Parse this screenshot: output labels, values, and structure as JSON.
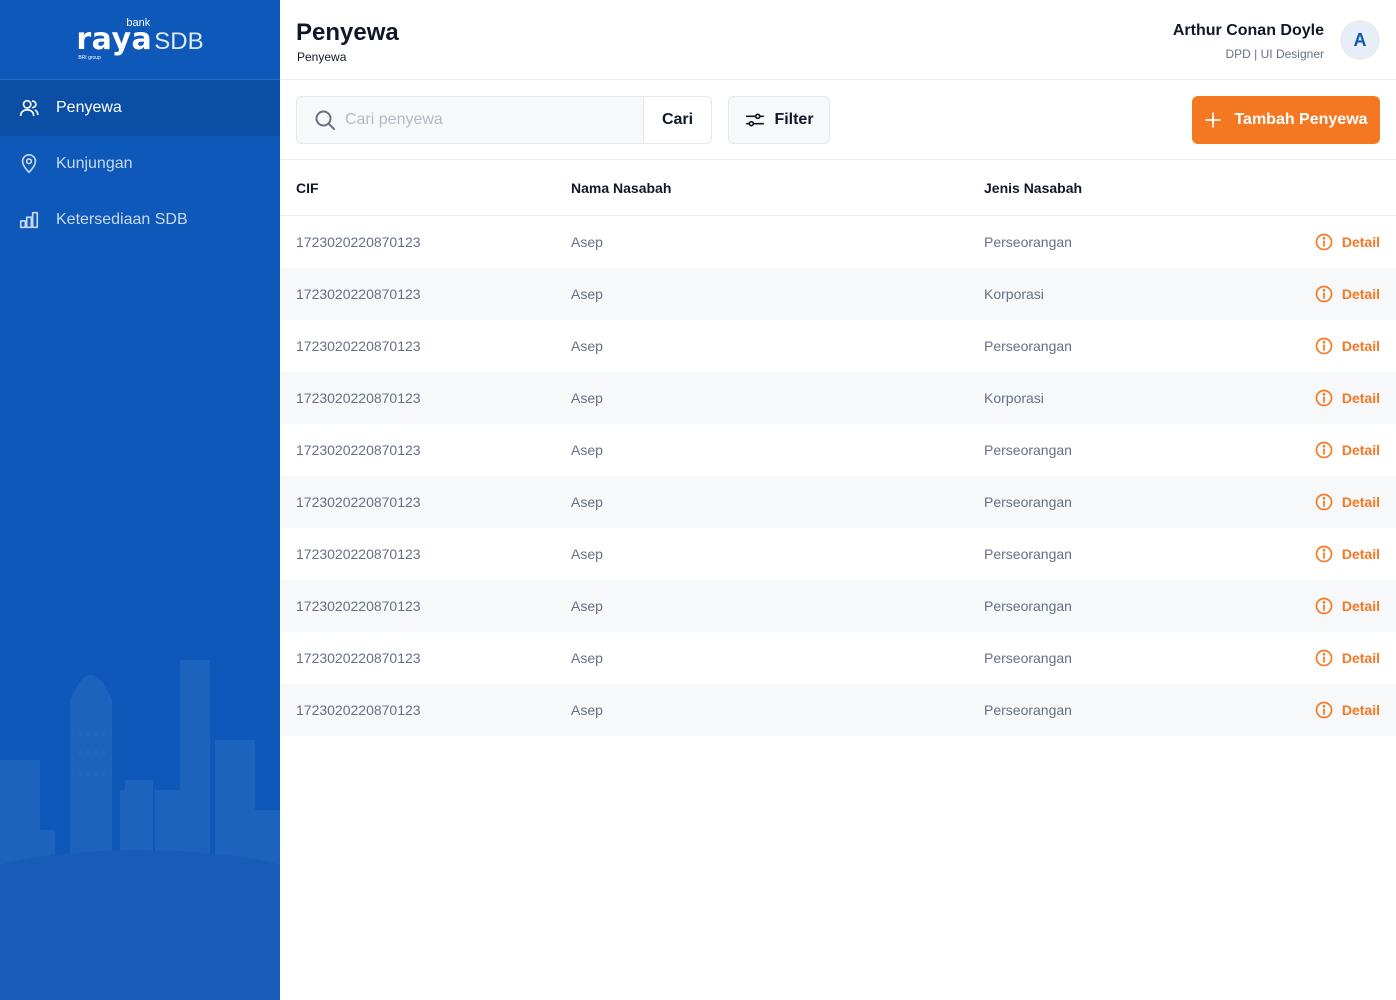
{
  "app": {
    "logo": {
      "bank": "bank",
      "raya": "raya",
      "sdb": "SDB",
      "group": "BRI group"
    }
  },
  "sidebar": {
    "items": [
      {
        "label": "Penyewa",
        "icon": "users-icon",
        "active": true
      },
      {
        "label": "Kunjungan",
        "icon": "location-pin-icon",
        "active": false
      },
      {
        "label": "Ketersediaan SDB",
        "icon": "bar-chart-icon",
        "active": false
      }
    ]
  },
  "header": {
    "title": "Penyewa",
    "breadcrumb": "Penyewa",
    "user": {
      "name": "Arthur Conan Doyle",
      "role": "DPD | UI Designer",
      "initial": "A"
    }
  },
  "toolbar": {
    "search_placeholder": "Cari penyewa",
    "search_value": "",
    "search_button": "Cari",
    "filter_button": "Filter",
    "add_button": "Tambah Penyewa"
  },
  "table": {
    "columns": [
      "CIF",
      "Nama Nasabah",
      "Jenis Nasabah"
    ],
    "action_label": "Detail",
    "rows": [
      {
        "cif": "1723020220870123",
        "name": "Asep",
        "type": "Perseorangan"
      },
      {
        "cif": "1723020220870123",
        "name": "Asep",
        "type": "Korporasi"
      },
      {
        "cif": "1723020220870123",
        "name": "Asep",
        "type": "Perseorangan"
      },
      {
        "cif": "1723020220870123",
        "name": "Asep",
        "type": "Korporasi"
      },
      {
        "cif": "1723020220870123",
        "name": "Asep",
        "type": "Perseorangan"
      },
      {
        "cif": "1723020220870123",
        "name": "Asep",
        "type": "Perseorangan"
      },
      {
        "cif": "1723020220870123",
        "name": "Asep",
        "type": "Perseorangan"
      },
      {
        "cif": "1723020220870123",
        "name": "Asep",
        "type": "Perseorangan"
      },
      {
        "cif": "1723020220870123",
        "name": "Asep",
        "type": "Perseorangan"
      },
      {
        "cif": "1723020220870123",
        "name": "Asep",
        "type": "Perseorangan"
      }
    ]
  },
  "colors": {
    "sidebar": "#0d58b8",
    "sidebar_active": "#0a4ea6",
    "accent": "#f47721",
    "text_dark": "#101828",
    "text_muted": "#667085"
  }
}
